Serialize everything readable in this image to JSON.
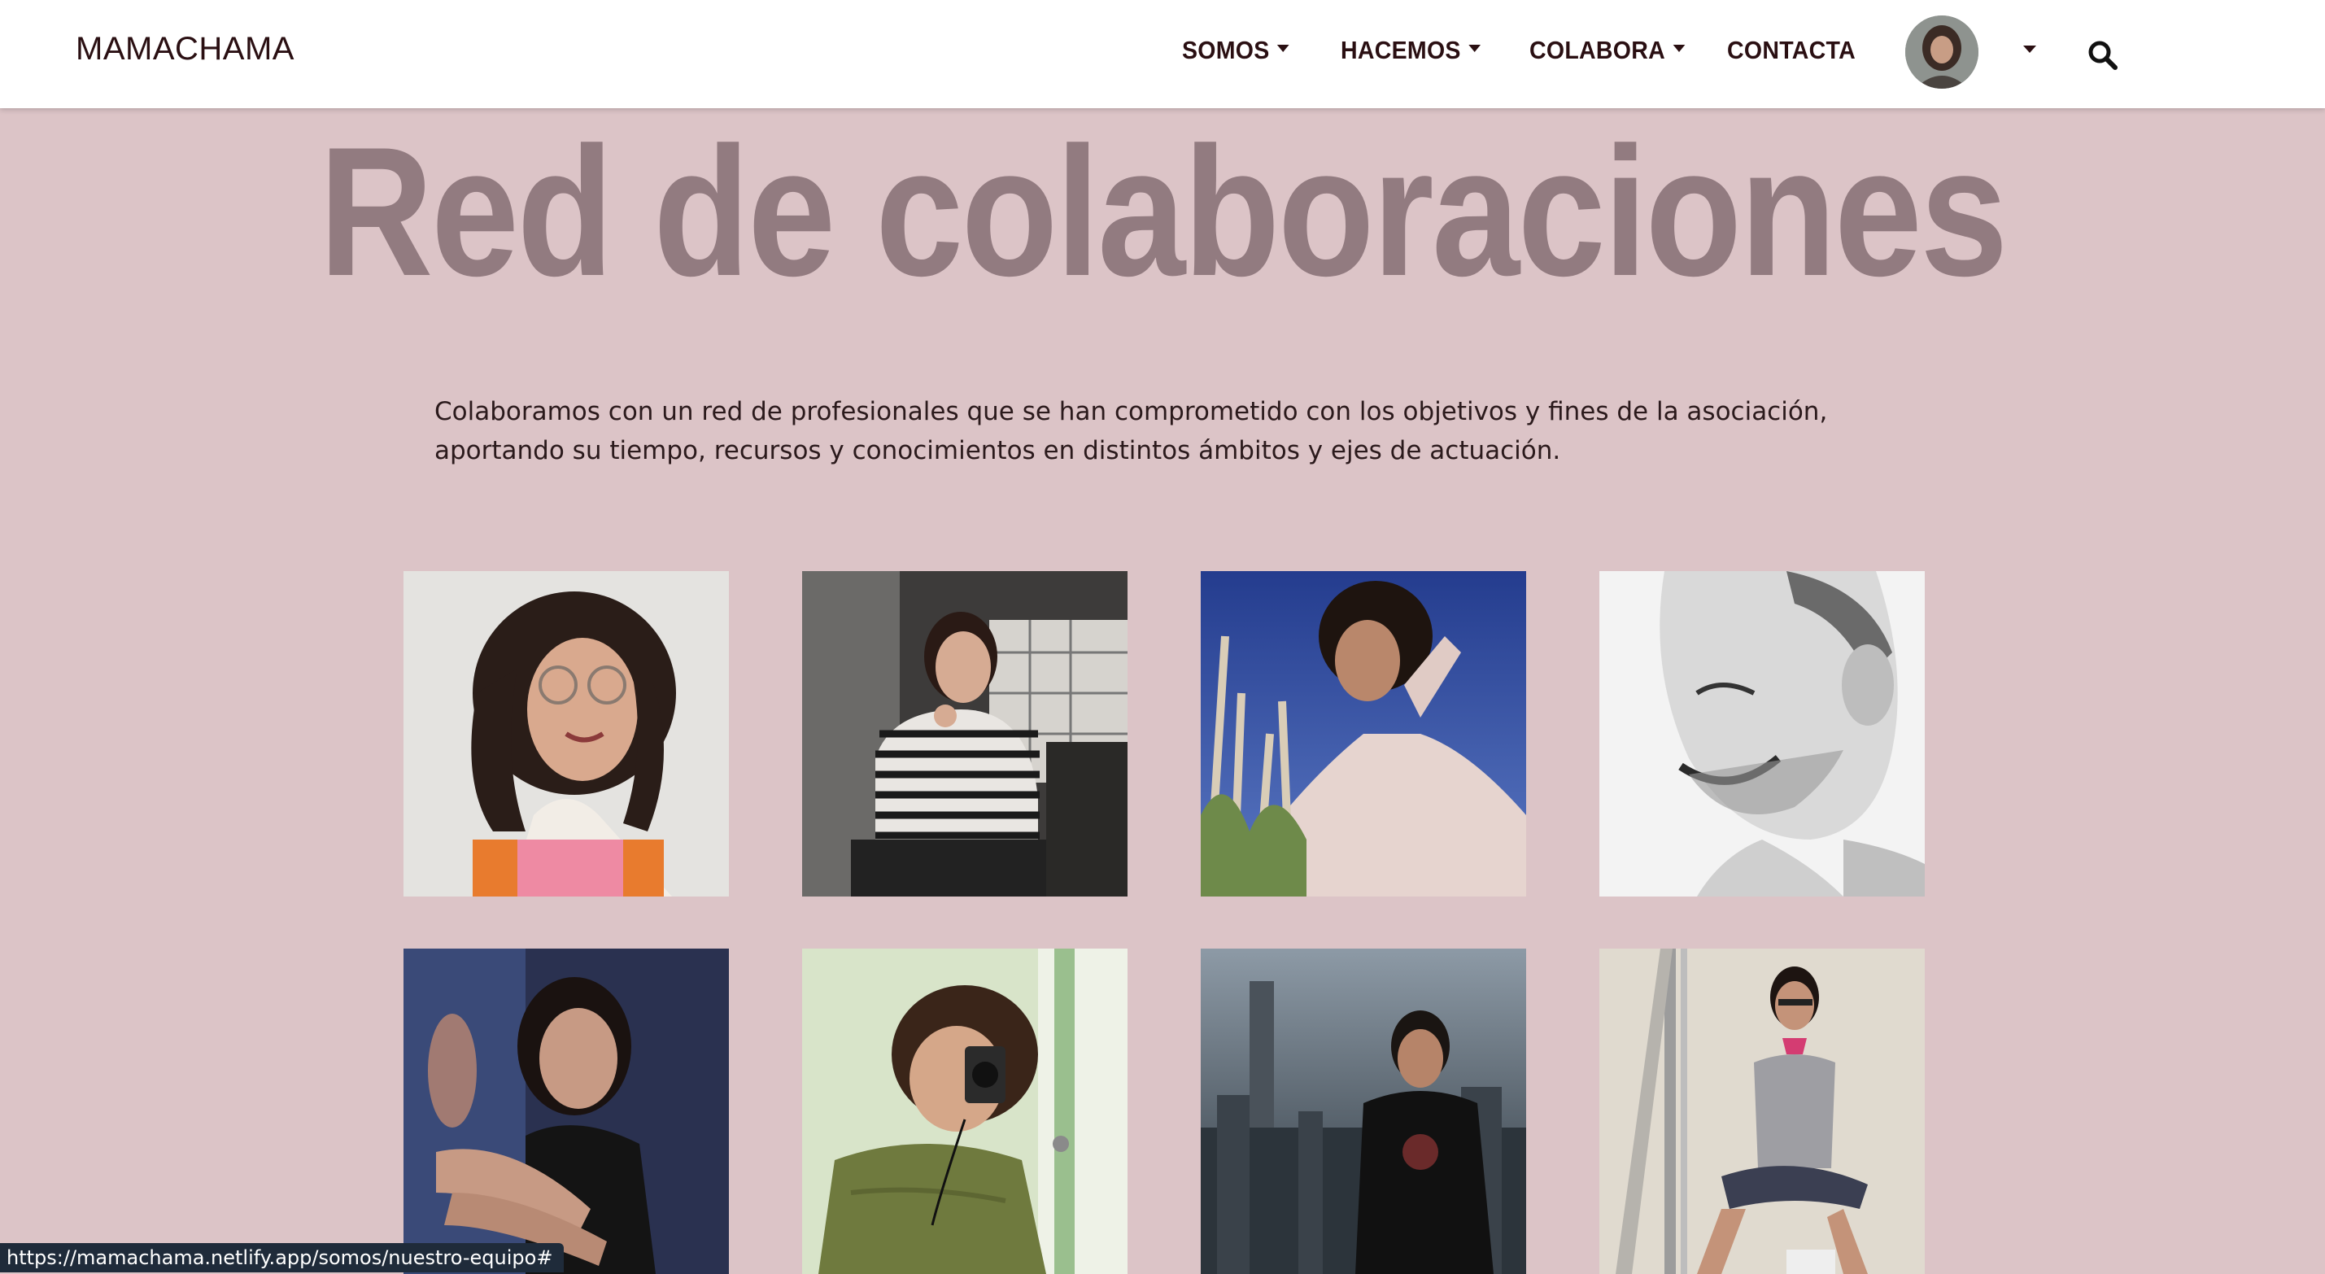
{
  "navbar": {
    "brand": "MAMACHAMA",
    "items": [
      {
        "label": "SOMOS",
        "has_dropdown": true
      },
      {
        "label": "HACEMOS",
        "has_dropdown": true
      },
      {
        "label": "COLABORA",
        "has_dropdown": true
      },
      {
        "label": "CONTACTA",
        "has_dropdown": false
      }
    ],
    "icons": [
      "user-avatar",
      "chevron-down-icon",
      "search-icon"
    ]
  },
  "main": {
    "title": "Red de colaboraciones",
    "intro": "Colaboramos con un red de profesionales que se han comprometido con los objetivos y fines de la asociación, aportando su tiempo, recursos y conocimientos en distintos ámbitos y ejes de actuación.",
    "collaborators": [
      {
        "photo": "woman-curly-hair-glasses"
      },
      {
        "photo": "woman-striped-shirt-kitchen"
      },
      {
        "photo": "man-curly-hair-blue-sky"
      },
      {
        "photo": "man-black-white-profile"
      },
      {
        "photo": "woman-black-tank-top"
      },
      {
        "photo": "woman-with-camera"
      },
      {
        "photo": "man-city-skyline"
      },
      {
        "photo": "woman-sitting-sunglasses"
      }
    ]
  },
  "statusbar": {
    "url": "https://mamachama.netlify.app/somos/nuestro-equipo#"
  },
  "colors": {
    "background": "#dcc4c7",
    "title": "#927b80",
    "nav_text": "#2a0f12",
    "navbar_bg": "#ffffff"
  }
}
